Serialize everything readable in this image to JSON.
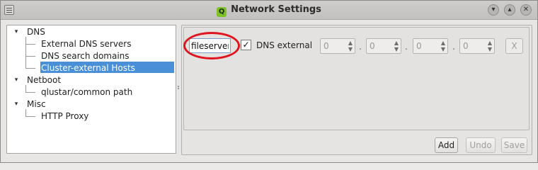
{
  "window": {
    "title": "Network Settings",
    "logo_letter": "Q",
    "controls": {
      "minimize": "▾",
      "maximize": "▴",
      "close": "✕"
    }
  },
  "tree": {
    "groups": [
      {
        "label": "DNS",
        "expanded": true,
        "children": [
          "External DNS servers",
          "DNS search domains",
          "Cluster-external Hosts"
        ]
      },
      {
        "label": "Netboot",
        "expanded": true,
        "children": [
          "qlustar/common path"
        ]
      },
      {
        "label": "Misc",
        "expanded": true,
        "children": [
          "HTTP Proxy"
        ]
      }
    ],
    "selected": "Cluster-external Hosts",
    "arrow_glyph": "▾"
  },
  "host_entry": {
    "hostname_value": "fileserver",
    "dns_external_checked": true,
    "check_glyph": "✓",
    "dns_external_label": "DNS external",
    "ip_octets": [
      "0",
      "0",
      "0",
      "0"
    ],
    "separator": ".",
    "spin_arrows": "▲▼",
    "remove_label": "X"
  },
  "buttons": {
    "add": "Add",
    "undo": "Undo",
    "save": "Save"
  },
  "colors": {
    "selection": "#4a90d9",
    "annotation_circle": "#e0141e",
    "logo_green": "#7fc12b"
  }
}
